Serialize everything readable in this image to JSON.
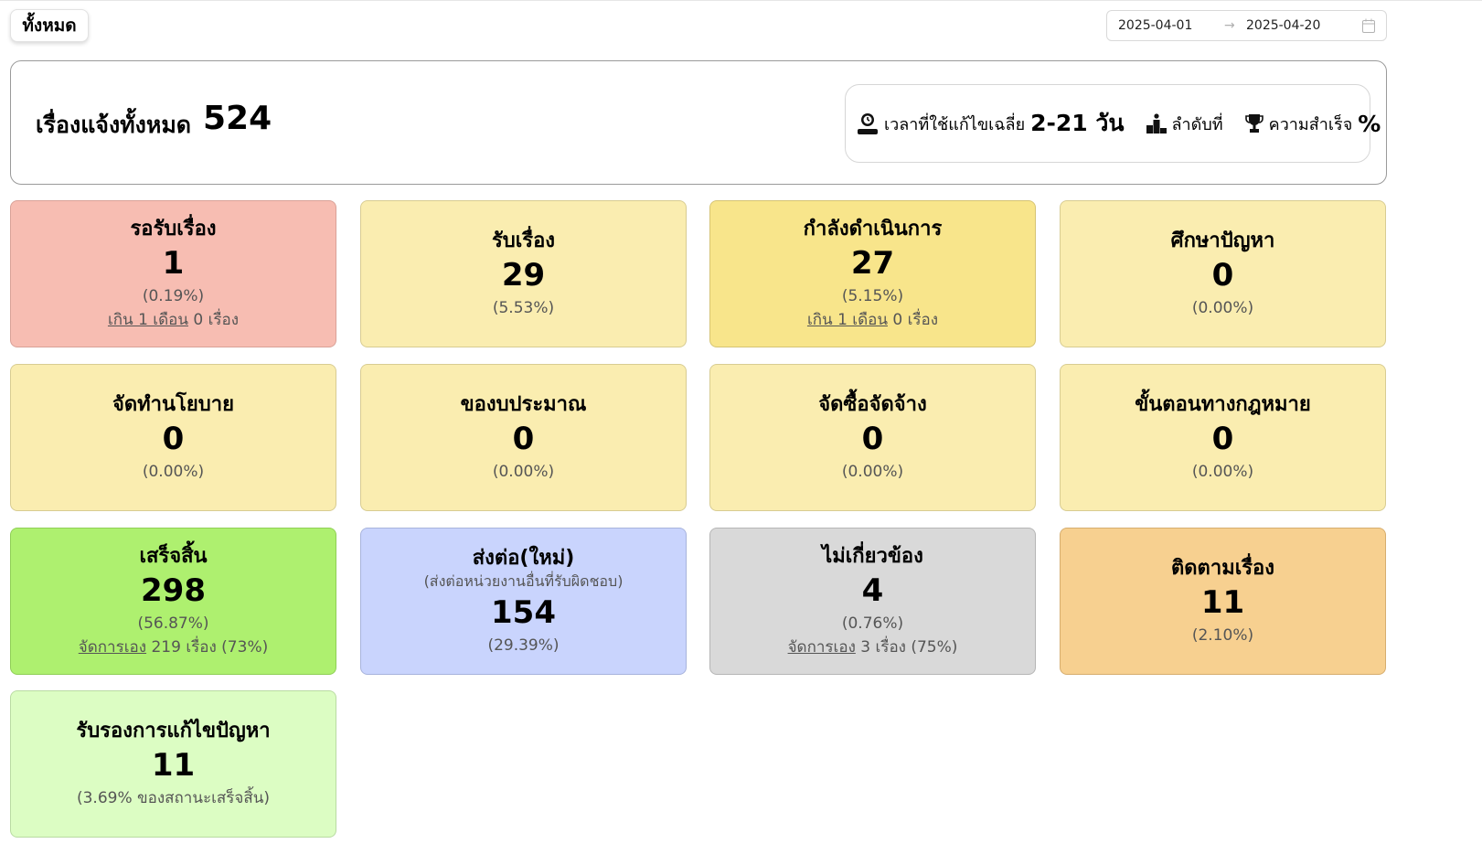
{
  "filter": {
    "label": "ทั้งหมด"
  },
  "date_range": {
    "start": "2025-04-01",
    "end": "2025-04-20",
    "arrow": "→"
  },
  "summary": {
    "label": "เรื่องแจ้งทั้งหมด",
    "total": "524",
    "avg_time_label": "เวลาที่ใช้แก้ไขเฉลี่ย",
    "avg_time_value": "2-21 วัน",
    "rank_label": "ลำดับที่",
    "success_label": "ความสำเร็จ",
    "success_value": "%"
  },
  "cards": {
    "waiting": {
      "title": "รอรับเรื่อง",
      "count": "1",
      "pct": "(0.19%)",
      "link": "เกิน 1 เดือน",
      "extra": " 0 เรื่อง"
    },
    "received": {
      "title": "รับเรื่อง",
      "count": "29",
      "pct": "(5.53%)"
    },
    "in_progress": {
      "title": "กำลังดำเนินการ",
      "count": "27",
      "pct": "(5.15%)",
      "link": "เกิน 1 เดือน",
      "extra": " 0 เรื่อง"
    },
    "study": {
      "title": "ศึกษาปัญหา",
      "count": "0",
      "pct": "(0.00%)"
    },
    "policy": {
      "title": "จัดทำนโยบาย",
      "count": "0",
      "pct": "(0.00%)"
    },
    "budget": {
      "title": "ของบประมาณ",
      "count": "0",
      "pct": "(0.00%)"
    },
    "procurement": {
      "title": "จัดซื้อจัดจ้าง",
      "count": "0",
      "pct": "(0.00%)"
    },
    "legal": {
      "title": "ขั้นตอนทางกฎหมาย",
      "count": "0",
      "pct": "(0.00%)"
    },
    "done": {
      "title": "เสร็จสิ้น",
      "count": "298",
      "pct": "(56.87%)",
      "link": "จัดการเอง",
      "extra": " 219 เรื่อง (73%)"
    },
    "forwarded": {
      "title": "ส่งต่อ(ใหม่)",
      "sub": "(ส่งต่อหน่วยงานอื่นที่รับผิดชอบ)",
      "count": "154",
      "pct": "(29.39%)"
    },
    "unrelated": {
      "title": "ไม่เกี่ยวข้อง",
      "count": "4",
      "pct": "(0.76%)",
      "link": "จัดการเอง",
      "extra": " 3 เรื่อง (75%)"
    },
    "follow_up": {
      "title": "ติดตามเรื่อง",
      "count": "11",
      "pct": "(2.10%)"
    },
    "certified": {
      "title": "รับรองการแก้ไขปัญหา",
      "count": "11",
      "pct": "(3.69% ของสถานะเสร็จสิ้น)"
    }
  },
  "colors": {
    "waiting": "#f7bdb2",
    "yellow_light": "#faedb0",
    "yellow": "#f8e58b",
    "green": "#aef06f",
    "blue": "#c9d4fd",
    "gray": "#d9d9d9",
    "orange": "#f7d090",
    "green_light": "#dcfdc3"
  }
}
